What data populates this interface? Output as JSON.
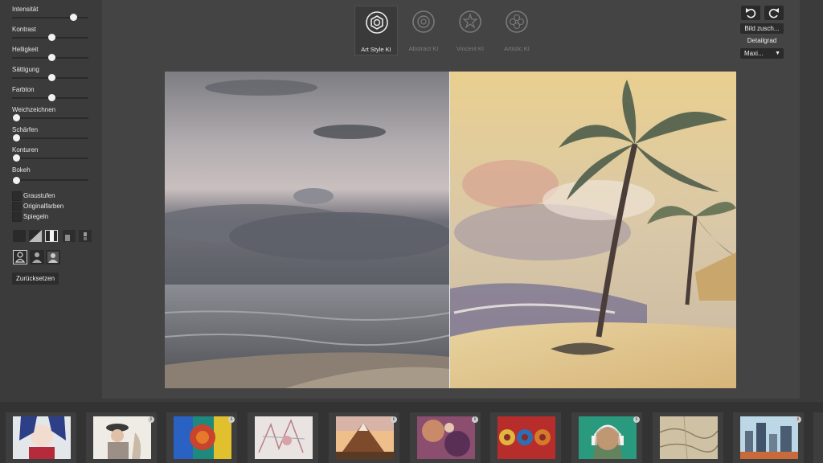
{
  "sidebar": {
    "sliders": [
      {
        "label": "Intensität",
        "value": 0.8
      },
      {
        "label": "Kontrast",
        "value": 0.52
      },
      {
        "label": "Helligkeit",
        "value": 0.52
      },
      {
        "label": "Sättigung",
        "value": 0.52
      },
      {
        "label": "Farbton",
        "value": 0.52
      },
      {
        "label": "Weichzeichnen",
        "value": 0.05
      },
      {
        "label": "Schärfen",
        "value": 0.05
      },
      {
        "label": "Konturen",
        "value": 0.05
      },
      {
        "label": "Bokeh",
        "value": 0.05
      }
    ],
    "checkboxes": [
      {
        "label": "Graustufen",
        "checked": false
      },
      {
        "label": "Originalfarben",
        "checked": false
      },
      {
        "label": "Spiegeln",
        "checked": false
      }
    ],
    "reset_label": "Zurücksetzen"
  },
  "style_tabs": [
    {
      "label": "Art Style KI",
      "active": true,
      "icon": "hexagon-icon"
    },
    {
      "label": "Abstract KI",
      "active": false,
      "icon": "circle-icon"
    },
    {
      "label": "Vincent KI",
      "active": false,
      "icon": "star-icon"
    },
    {
      "label": "Artistic KI",
      "active": false,
      "icon": "flower-icon"
    }
  ],
  "toolbar": {
    "undo_icon": "undo-icon",
    "redo_icon": "redo-icon",
    "zoom_label": "Bild zusch...",
    "detail_label": "Detailgrad",
    "detail_value": "Maxi..."
  },
  "filmstrip": {
    "thumbnails": [
      {
        "name": "thumb-geisha"
      },
      {
        "name": "thumb-hat-woman"
      },
      {
        "name": "thumb-color-lion"
      },
      {
        "name": "thumb-sketch"
      },
      {
        "name": "thumb-mountain"
      },
      {
        "name": "thumb-abstract-purple"
      },
      {
        "name": "thumb-barrels"
      },
      {
        "name": "thumb-headphones"
      },
      {
        "name": "thumb-map"
      },
      {
        "name": "thumb-city"
      }
    ],
    "info_symbol": "i"
  },
  "colors": {
    "panel": "#3b3b3b",
    "stage": "#444444",
    "accent": "#f2f2f2"
  }
}
